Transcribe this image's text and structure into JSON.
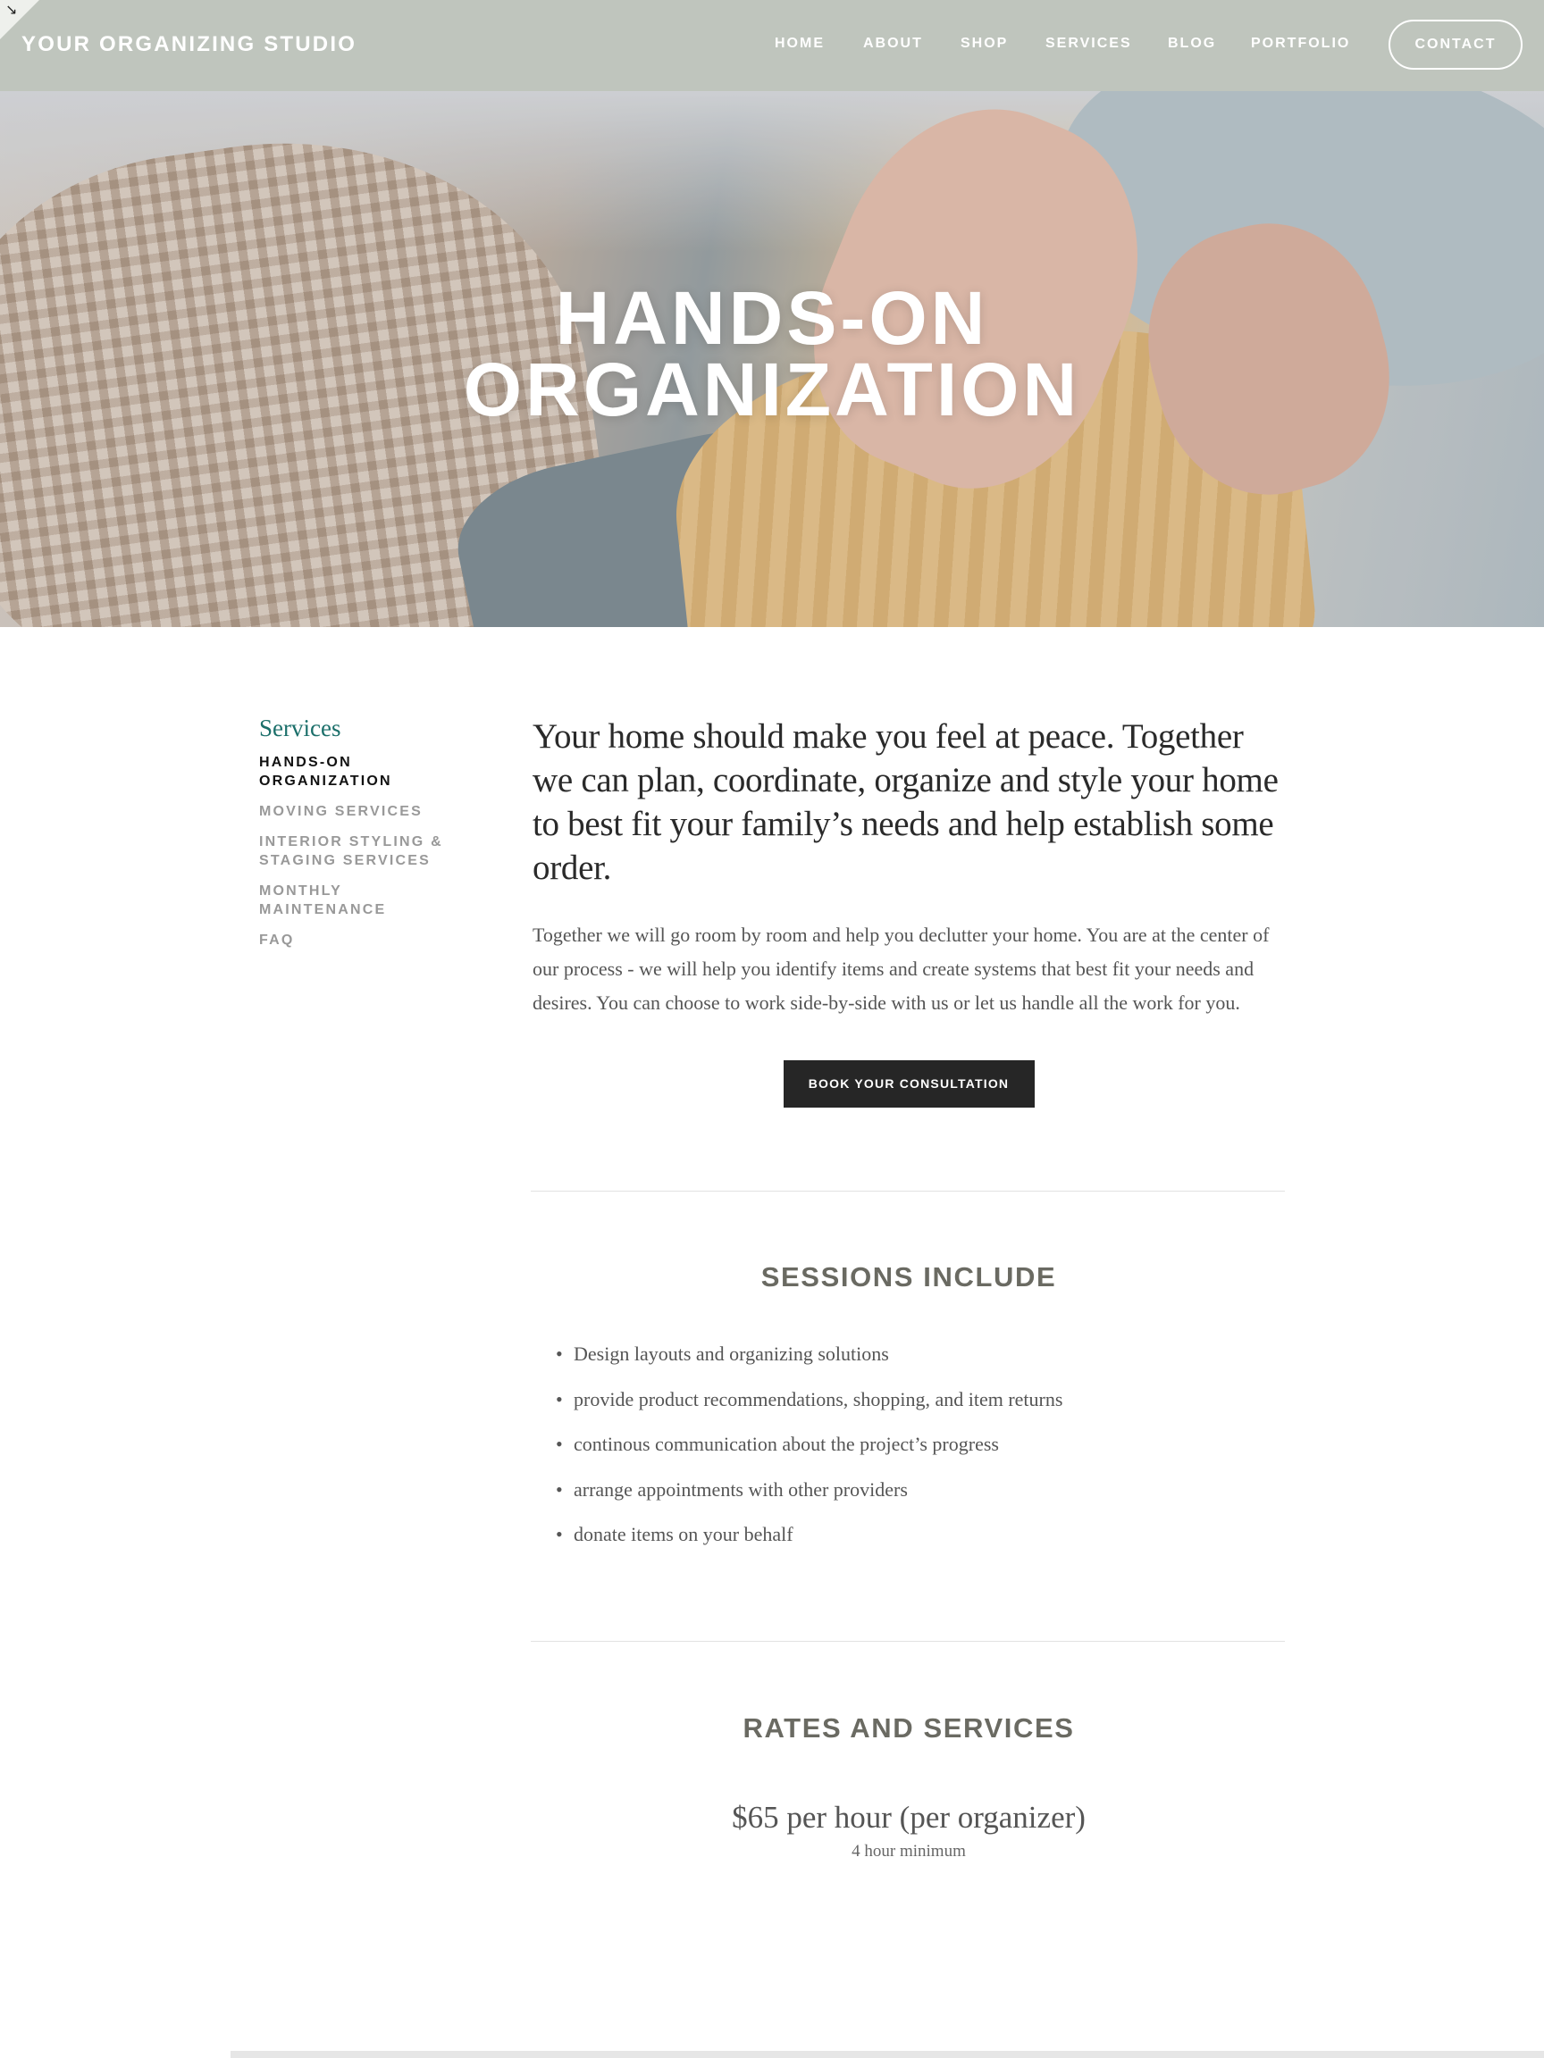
{
  "header": {
    "site_title": "YOUR ORGANIZING STUDIO",
    "nav": [
      "HOME",
      "ABOUT",
      "SHOP",
      "SERVICES",
      "BLOG",
      "PORTFOLIO"
    ],
    "contact_label": "CONTACT"
  },
  "hero": {
    "title_line1": "HANDS-ON",
    "title_line2": "ORGANIZATION"
  },
  "sidebar": {
    "heading": "Services",
    "items": [
      {
        "line1": "HANDS-ON",
        "line2": "ORGANIZATION"
      },
      {
        "line1": "MOVING SERVICES",
        "line2": ""
      },
      {
        "line1": "INTERIOR STYLING &",
        "line2": "STAGING SERVICES"
      },
      {
        "line1": "MONTHLY",
        "line2": "MAINTENANCE"
      },
      {
        "line1": "FAQ",
        "line2": ""
      }
    ]
  },
  "main": {
    "lead": "Your home should make you feel at peace. Together we can plan, coordinate, organize and style your home to best fit your family’s needs and help establish some order.",
    "body": "Together we will go room by room and help you declutter your home. You are at the center of our process - we will help you identify items and create systems that best fit your needs and desires. You can choose to work side-by-side with us or let us handle all the work for you.",
    "cta_label": "BOOK YOUR CONSULTATION"
  },
  "sessions": {
    "title": "SESSIONS INCLUDE",
    "items": [
      "Design layouts and organizing solutions",
      "provide product recommendations, shopping, and item returns",
      "continous communication about the project’s progress",
      "arrange appointments with other providers",
      "donate items on your behalf"
    ]
  },
  "rates": {
    "title": "RATES AND SERVICES",
    "price": "$65 per hour (per organizer)",
    "note": "4 hour minimum"
  },
  "colors": {
    "header_bg": "#bfc5bd",
    "accent": "#1b6f6a",
    "button_bg": "#262626"
  },
  "icons": {
    "corner": "expand-arrow-icon"
  }
}
